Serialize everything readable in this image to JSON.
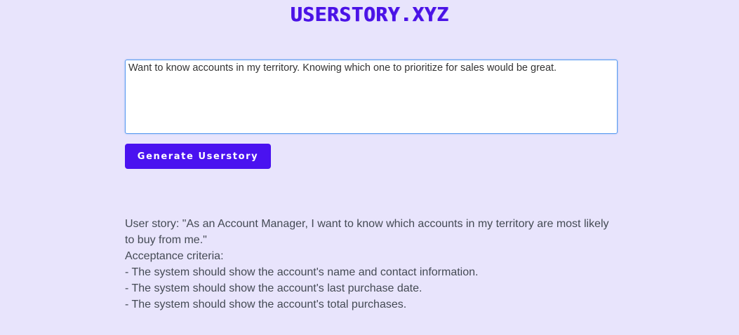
{
  "header": {
    "logo_text": "USERSTORY.XYZ"
  },
  "input": {
    "value": "Want to know accounts in my territory. Knowing which one to prioritize for sales would be great."
  },
  "button": {
    "label": "Generate Userstory"
  },
  "output": {
    "lines": [
      "User story: \"As an Account Manager, I want to know which accounts in my territory are most likely",
      "to buy from me.\"",
      "Acceptance criteria:",
      "- The system should show the account's name and contact information.",
      "- The system should show the account's last purchase date.",
      "- The system should show the account's total purchases."
    ]
  },
  "colors": {
    "background": "#e8e4fc",
    "accent": "#4a12f0",
    "logo": "#4a12e6"
  }
}
